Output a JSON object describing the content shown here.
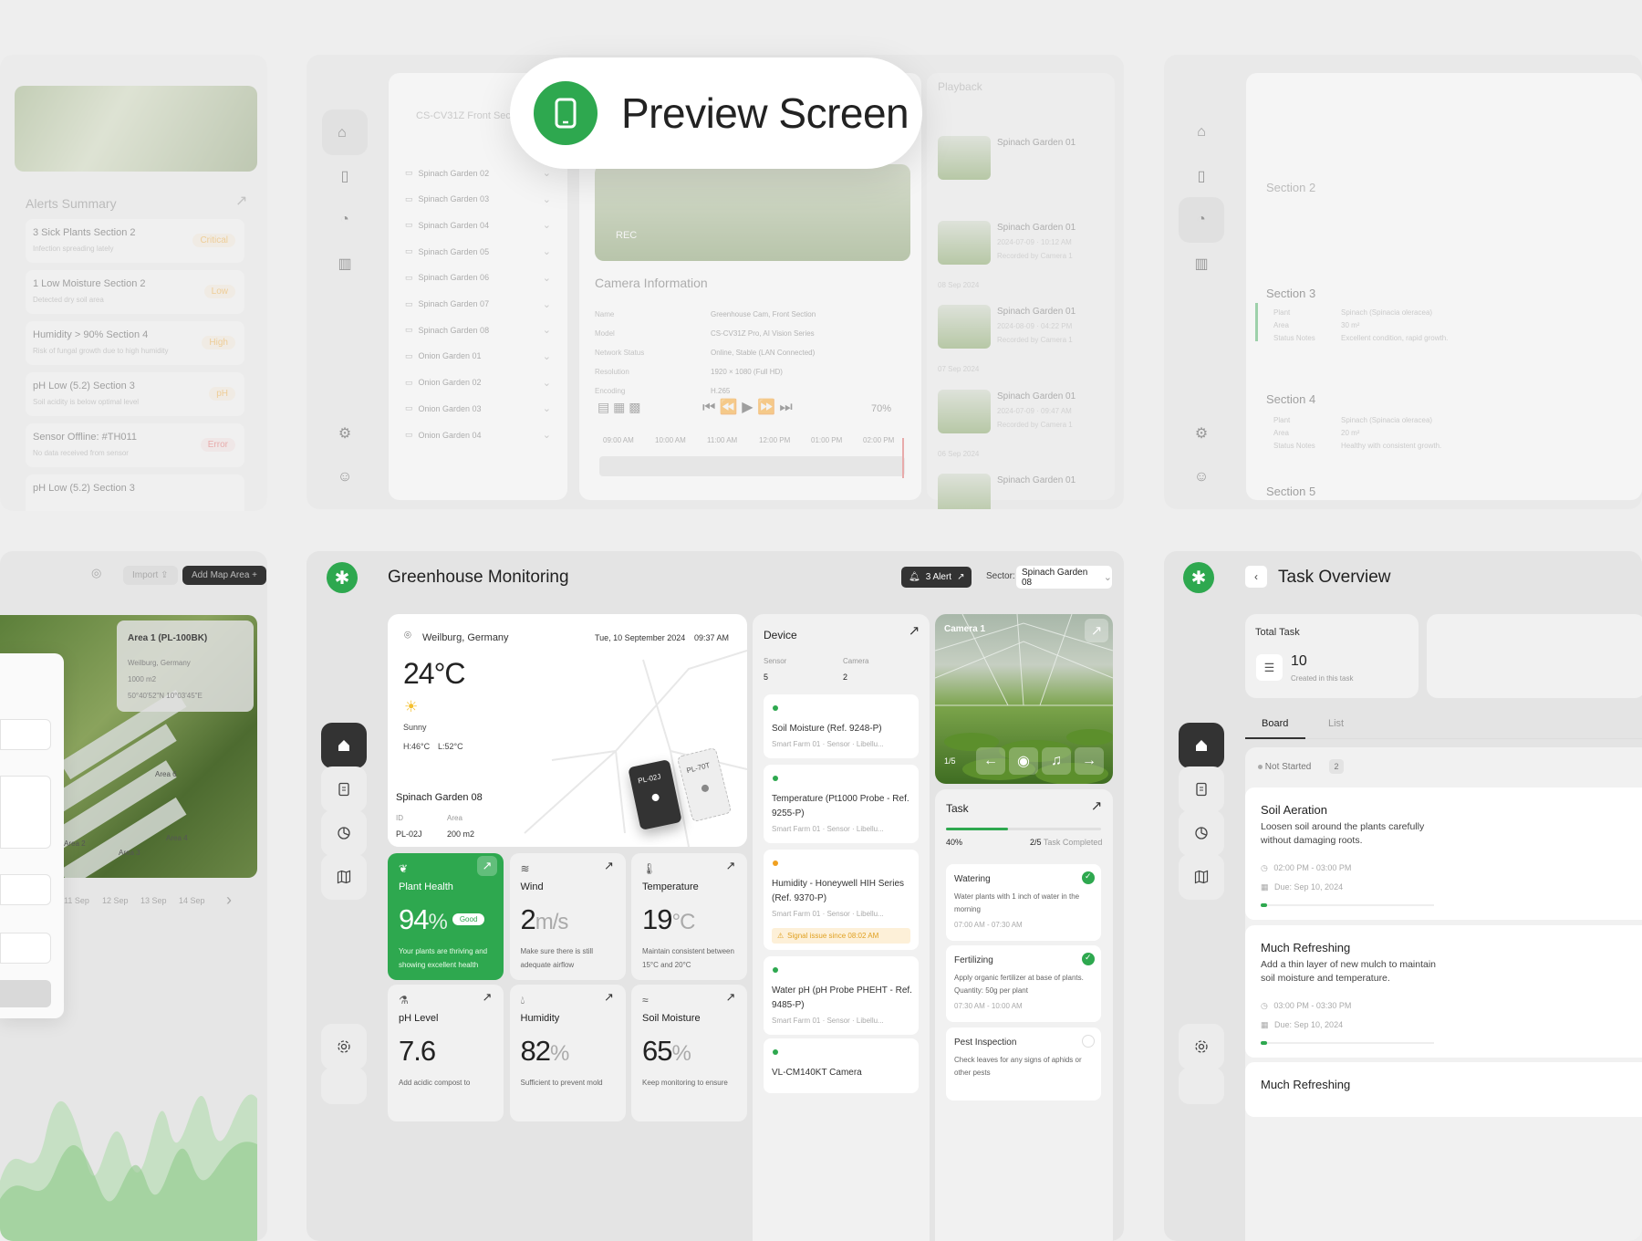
{
  "badge": {
    "title": "Preview Screen"
  },
  "top_left": {
    "alerts_title": "Alerts Summary",
    "alerts": [
      {
        "title": "3 Sick Plants Section 2",
        "sub": "Infection spreading lately",
        "level": "Critical"
      },
      {
        "title": "1 Low Moisture Section 2",
        "sub": "Detected dry soil area",
        "level": "Low"
      },
      {
        "title": "Humidity > 90% Section 4",
        "sub": "Risk of fungal growth due to high humidity",
        "level": "High"
      },
      {
        "title": "pH Low (5.2) Section 3",
        "sub": "Soil acidity is below optimal level",
        "level": "pH"
      },
      {
        "title": "Sensor Offline: #TH011",
        "sub": "No data received from sensor",
        "level": "Error"
      },
      {
        "title": "pH Low (5.2) Section 3",
        "sub": "",
        "level": ""
      }
    ]
  },
  "top_center": {
    "camera_dropdown": "CS-CV31Z Front Section",
    "gardens": [
      "Spinach Garden 02",
      "Spinach Garden 03",
      "Spinach Garden 04",
      "Spinach Garden 05",
      "Spinach Garden 06",
      "Spinach Garden 07",
      "Spinach Garden 08",
      "Onion Garden 01",
      "Onion Garden 02",
      "Onion Garden 03",
      "Onion Garden 04"
    ],
    "rec_label": "REC",
    "camera_info_title": "Camera Information",
    "camera_info": [
      {
        "k": "Name",
        "v": "Greenhouse Cam, Front Section"
      },
      {
        "k": "Model",
        "v": "CS-CV31Z Pro, AI Vision Series"
      },
      {
        "k": "Network Status",
        "v": "Online, Stable (LAN Connected)"
      },
      {
        "k": "Resolution",
        "v": "1920 × 1080 (Full HD)"
      },
      {
        "k": "Encoding",
        "v": "H.265"
      }
    ],
    "zoom": "70%",
    "timeline": [
      "09:00 AM",
      "10:00 AM",
      "11:00 AM",
      "12:00 PM",
      "01:00 PM",
      "02:00 PM"
    ],
    "playback_title": "Playback",
    "recordings": [
      {
        "title": "Spinach Garden 01",
        "date": "",
        "by": ""
      },
      {
        "title": "Spinach Garden 01",
        "date": "2024-07-09 · 10:12 AM",
        "by": "Recorded by Camera 1"
      },
      {
        "title": "Spinach Garden 01",
        "date": "2024-08-09 · 04:22 PM",
        "by": "Recorded by Camera 1"
      },
      {
        "title": "Spinach Garden 01",
        "date": "2024-07-09 · 09:47 AM",
        "by": "Recorded by Camera 1"
      },
      {
        "title": "Spinach Garden 01",
        "date": "",
        "by": ""
      }
    ],
    "date_groups": [
      "08 Sep 2024",
      "07 Sep 2024",
      "06 Sep 2024"
    ]
  },
  "top_right": {
    "sections": [
      "Section 2",
      "Section 3",
      "Section 4",
      "Section 5"
    ],
    "s3_rows": [
      {
        "k": "Plant",
        "v": "Spinach (Spinacia oleracea)"
      },
      {
        "k": "Area",
        "v": "30 m²"
      },
      {
        "k": "Status Notes",
        "v": "Excellent condition, rapid growth."
      }
    ],
    "s4_rows": [
      {
        "k": "Plant",
        "v": "Spinach (Spinacia oleracea)"
      },
      {
        "k": "Area",
        "v": "20 m²"
      },
      {
        "k": "Status Notes",
        "v": "Healthy with consistent growth."
      }
    ]
  },
  "bottom_left": {
    "import": "Import",
    "add_map": "Add Map Area",
    "area_card": {
      "title": "Area 1 (PL-100BK)",
      "loc": "Weilburg, Germany",
      "size": "1000 m2",
      "coord": "50°40'52\"N 10°03'45\"E"
    },
    "map_labels": [
      "Area 6",
      "Area 2",
      "Area 3",
      "Area 4"
    ],
    "forecast": [
      "11 Sep",
      "12 Sep",
      "13 Sep",
      "14 Sep"
    ]
  },
  "main": {
    "title": "Greenhouse Monitoring",
    "alert_btn": "3 Alert",
    "sector_label": "Sector:",
    "sector_value": "Spinach Garden 08",
    "weather": {
      "location": "Weilburg, Germany",
      "date": "Tue, 10 September 2024",
      "time": "09:37 AM",
      "temp": "24°C",
      "condition": "Sunny",
      "high": "H:46°C",
      "low": "L:52°C",
      "garden_name": "Spinach Garden 08",
      "id_label": "ID",
      "id_value": "PL-02J",
      "area_label": "Area",
      "area_value": "200 m2",
      "map_tag1": "PL-02J",
      "map_tag2": "PL-70T"
    },
    "device": {
      "title": "Device",
      "sensor_label": "Sensor",
      "sensor_value": "5",
      "camera_label": "Camera",
      "camera_value": "2",
      "items": [
        {
          "name": "Soil Moisture (Ref. 9248-P)",
          "meta": "Smart Farm 01 · Sensor · Libellu...",
          "status": "ok"
        },
        {
          "name": "Temperature (Pt1000 Probe - Ref. 9255-P)",
          "meta": "Smart Farm 01 · Sensor · Libellu...",
          "status": "ok"
        },
        {
          "name": "Humidity - Honeywell HIH Series (Ref. 9370-P)",
          "meta": "Smart Farm 01 · Sensor · Libellu...",
          "status": "warn",
          "warning": "Signal issue since 08:02 AM"
        },
        {
          "name": "Water pH (pH Probe PHEHT - Ref. 9485-P)",
          "meta": "Smart Farm 01 · Sensor · Libellu...",
          "status": "ok"
        },
        {
          "name": "VL-CM140KT Camera",
          "meta": "",
          "status": "ok"
        }
      ]
    },
    "camera": {
      "label": "Camera 1",
      "page": "1/5"
    },
    "task": {
      "title": "Task",
      "percent_label": "40%",
      "progress": 0.4,
      "completed": "2/5",
      "completed_label": "Task Completed",
      "items": [
        {
          "title": "Watering",
          "desc": "Water plants with 1 inch of water in the morning",
          "time": "07:00 AM - 07:30 AM",
          "done": true
        },
        {
          "title": "Fertilizing",
          "desc": "Apply organic fertilizer at base of plants. Quantity: 50g per plant",
          "time": "07:30 AM - 10:00 AM",
          "done": true
        },
        {
          "title": "Pest Inspection",
          "desc": "Check leaves for any signs of aphids or other pests",
          "time": "",
          "done": false
        }
      ]
    },
    "metrics": [
      {
        "label": "Plant Health",
        "value": "94",
        "unit": "%",
        "badge": "Good",
        "desc": "Your plants are thriving and showing excellent health"
      },
      {
        "label": "Wind",
        "value": "2",
        "unit": "m/s",
        "badge": "",
        "desc": "Make sure there is still adequate airflow"
      },
      {
        "label": "Temperature",
        "value": "19",
        "unit": "°C",
        "badge": "",
        "desc": "Maintain consistent between 15°C and 20°C"
      },
      {
        "label": "pH Level",
        "value": "7.6",
        "unit": "",
        "badge": "",
        "desc": "Add acidic compost to"
      },
      {
        "label": "Humidity",
        "value": "82",
        "unit": "%",
        "badge": "",
        "desc": "Sufficient to prevent mold"
      },
      {
        "label": "Soil Moisture",
        "value": "65",
        "unit": "%",
        "badge": "",
        "desc": "Keep monitoring to ensure"
      }
    ]
  },
  "task_overview": {
    "title": "Task Overview",
    "total_label": "Total Task",
    "total_value": "10",
    "total_sub": "Created in this task",
    "tabs": [
      "Board",
      "List"
    ],
    "column": "Not Started",
    "column_count": "2",
    "cards": [
      {
        "title": "Soil Aeration",
        "desc": "Loosen soil around the plants carefully without damaging roots.",
        "time": "02:00 PM - 03:00 PM",
        "due": "Due: Sep 10, 2024"
      },
      {
        "title": "Much Refreshing",
        "desc": "Add a thin layer of new mulch to maintain soil moisture and temperature.",
        "time": "03:00 PM - 03:30 PM",
        "due": "Due: Sep 10, 2024"
      },
      {
        "title": "Much Refreshing",
        "desc": "",
        "time": "",
        "due": ""
      }
    ]
  },
  "colors": {
    "brand": "#2ea84f",
    "warn": "#f0a020",
    "error": "#e05050",
    "dark": "#333333"
  }
}
